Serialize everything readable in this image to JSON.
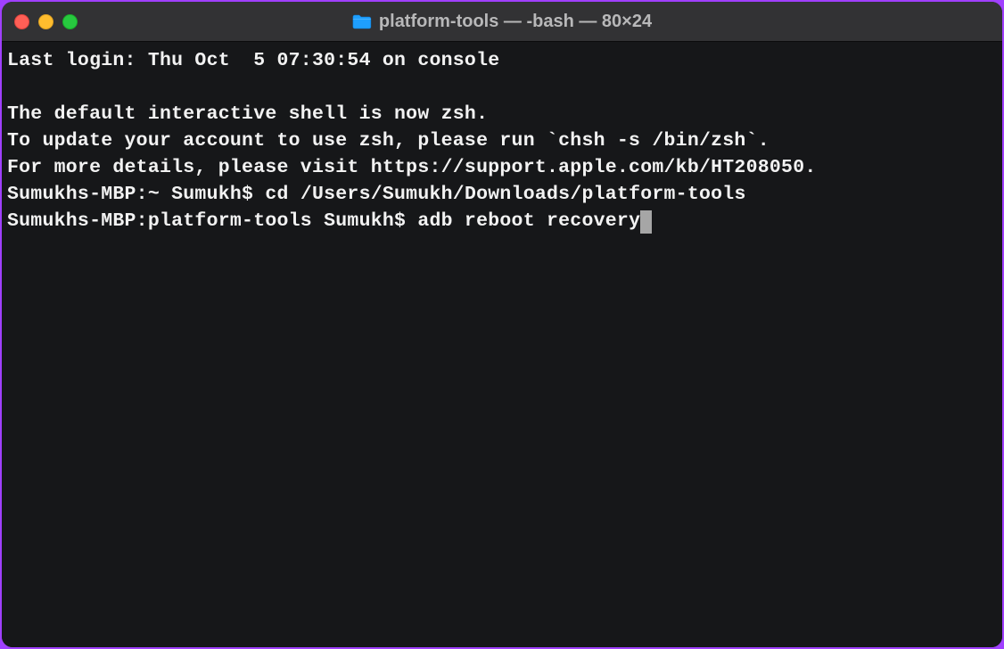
{
  "window": {
    "title": "platform-tools — -bash — 80×24"
  },
  "terminal": {
    "lines": {
      "l0": "Last login: Thu Oct  5 07:30:54 on console",
      "l1": "",
      "l2": "The default interactive shell is now zsh.",
      "l3": "To update your account to use zsh, please run `chsh -s /bin/zsh`.",
      "l4": "For more details, please visit https://support.apple.com/kb/HT208050.",
      "l5_prompt": "Sumukhs-MBP:~ Sumukh$ ",
      "l5_cmd": "cd /Users/Sumukh/Downloads/platform-tools",
      "l6_prompt": "Sumukhs-MBP:platform-tools Sumukh$ ",
      "l6_cmd": "adb reboot recovery"
    }
  }
}
